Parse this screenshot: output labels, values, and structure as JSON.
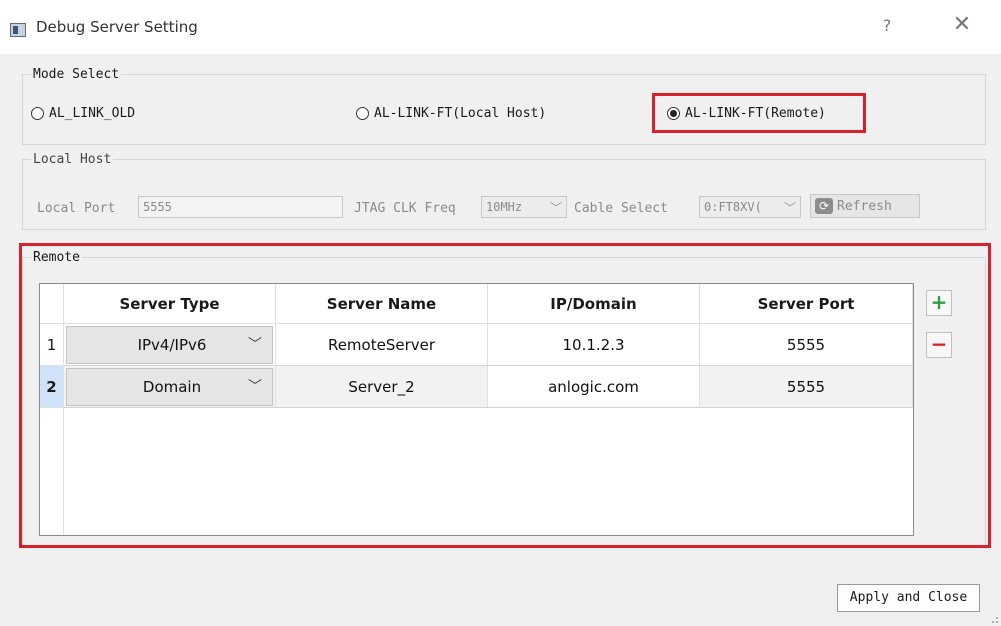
{
  "window": {
    "title": "Debug Server Setting",
    "help": "?",
    "close": "✕"
  },
  "mode_select": {
    "legend": "Mode Select",
    "options": [
      {
        "label": "AL_LINK_OLD",
        "checked": false
      },
      {
        "label": "AL-LINK-FT(Local Host)",
        "checked": false
      },
      {
        "label": "AL-LINK-FT(Remote)",
        "checked": true
      }
    ]
  },
  "local_host": {
    "legend": "Local Host",
    "local_port_label": "Local Port",
    "local_port_value": "5555",
    "jtag_label": "JTAG CLK Freq",
    "jtag_value": "10MHz",
    "cable_label": "Cable Select",
    "cable_value": "0:FT8XV(",
    "refresh_label": "Refresh"
  },
  "remote": {
    "legend": "Remote",
    "columns": [
      "Server Type",
      "Server Name",
      "IP/Domain",
      "Server Port"
    ],
    "rows": [
      {
        "index": "1",
        "server_type": "IPv4/IPv6",
        "server_name": "RemoteServer",
        "ip_domain": "10.1.2.3",
        "server_port": "5555",
        "selected": false
      },
      {
        "index": "2",
        "server_type": "Domain",
        "server_name": "Server_2",
        "ip_domain": "anlogic.com",
        "server_port": "5555",
        "selected": true
      }
    ],
    "add_label": "+",
    "remove_label": "−"
  },
  "apply_label": "Apply and Close",
  "colors": {
    "highlight": "#d9212e",
    "add": "#2ea043",
    "remove": "#d9212e",
    "selected_row_header": "#cfe3f8"
  }
}
